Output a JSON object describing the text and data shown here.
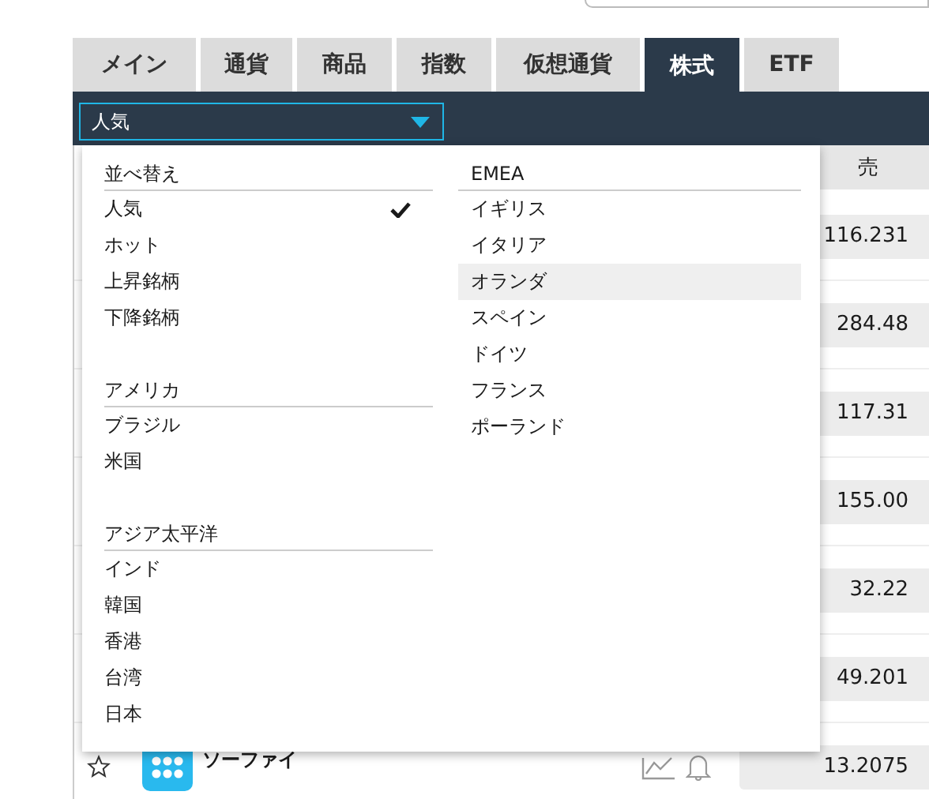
{
  "tabs": [
    {
      "label": "メイン",
      "selected": false
    },
    {
      "label": "通貨",
      "selected": false
    },
    {
      "label": "商品",
      "selected": false
    },
    {
      "label": "指数",
      "selected": false
    },
    {
      "label": "仮想通貨",
      "selected": false
    },
    {
      "label": "株式",
      "selected": true
    },
    {
      "label": "ETF",
      "selected": false
    }
  ],
  "filter_select": {
    "value": "人気"
  },
  "table": {
    "columns": [
      {
        "label": "売"
      }
    ],
    "rows": [
      {
        "sell": "116.231"
      },
      {
        "sell": "284.48"
      },
      {
        "sell": "117.31"
      },
      {
        "sell": "155.00"
      },
      {
        "sell": "32.22"
      },
      {
        "sell": "49.201"
      },
      {
        "name": "ソーファイ",
        "sell": "13.2075"
      }
    ]
  },
  "menu": {
    "columns": [
      {
        "groups": [
          {
            "heading": "並べ替え",
            "items": [
              {
                "label": "人気",
                "selected": true,
                "hovered": false
              },
              {
                "label": "ホット",
                "selected": false,
                "hovered": false
              },
              {
                "label": "上昇銘柄",
                "selected": false,
                "hovered": false
              },
              {
                "label": "下降銘柄",
                "selected": false,
                "hovered": false
              }
            ]
          },
          {
            "heading": "アメリカ",
            "items": [
              {
                "label": "ブラジル",
                "selected": false,
                "hovered": false
              },
              {
                "label": "米国",
                "selected": false,
                "hovered": false
              }
            ]
          },
          {
            "heading": "アジア太平洋",
            "items": [
              {
                "label": "インド",
                "selected": false,
                "hovered": false
              },
              {
                "label": "韓国",
                "selected": false,
                "hovered": false
              },
              {
                "label": "香港",
                "selected": false,
                "hovered": false
              },
              {
                "label": "台湾",
                "selected": false,
                "hovered": false
              },
              {
                "label": "日本",
                "selected": false,
                "hovered": false
              }
            ]
          }
        ]
      },
      {
        "groups": [
          {
            "heading": "EMEA",
            "items": [
              {
                "label": "イギリス",
                "selected": false,
                "hovered": false
              },
              {
                "label": "イタリア",
                "selected": false,
                "hovered": false
              },
              {
                "label": "オランダ",
                "selected": false,
                "hovered": true
              },
              {
                "label": "スペイン",
                "selected": false,
                "hovered": false
              },
              {
                "label": "ドイツ",
                "selected": false,
                "hovered": false
              },
              {
                "label": "フランス",
                "selected": false,
                "hovered": false
              },
              {
                "label": "ポーランド",
                "selected": false,
                "hovered": false
              }
            ]
          }
        ]
      }
    ]
  }
}
